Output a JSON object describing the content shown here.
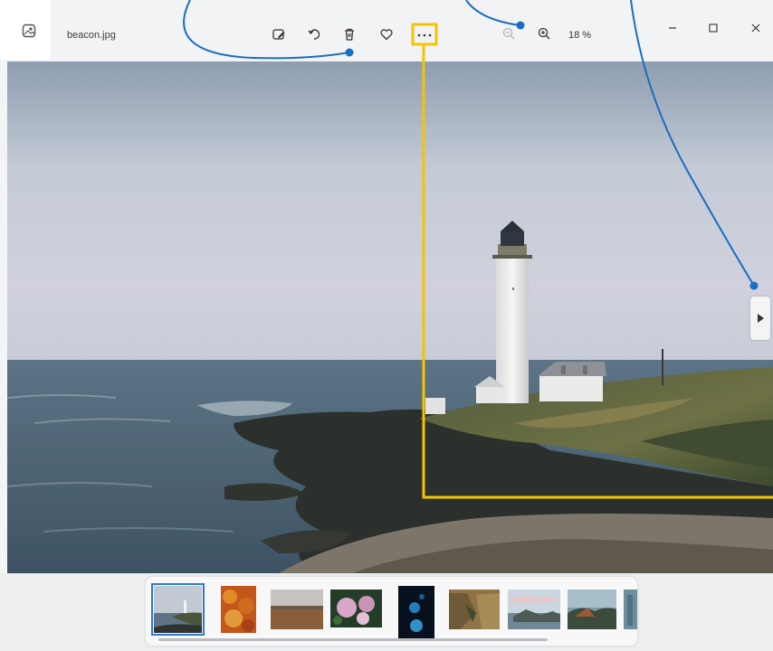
{
  "titlebar": {
    "filename": "beacon.jpg",
    "zoom_level": "18 %",
    "toolbar_icons": [
      "edit-image-icon",
      "rotate-icon",
      "delete-icon",
      "favorite-icon",
      "more-options-icon",
      "zoom-out-icon",
      "zoom-in-icon"
    ],
    "window_controls": [
      "minimize",
      "maximize",
      "close"
    ]
  },
  "photo": {
    "subject": "lighthouse-seascape",
    "sky_color": "#b9c2cf",
    "sea_color": "#4a6377"
  },
  "filmstrip": {
    "selected_index": 0,
    "thumbnails": [
      {
        "name": "thumb-beacon",
        "color": "#9fb0bd"
      },
      {
        "name": "thumb-autumn-leaves",
        "color": "#c9641e"
      },
      {
        "name": "thumb-sunset-field",
        "color": "#8a6a4c"
      },
      {
        "name": "thumb-hydrangea",
        "color": "#3d5a35"
      },
      {
        "name": "thumb-jellyfish",
        "color": "#0c1b2c"
      },
      {
        "name": "thumb-rocky-canyon",
        "color": "#8b6f45"
      },
      {
        "name": "thumb-coastal-clouds",
        "color": "#b9c7d4"
      },
      {
        "name": "thumb-coast-cliffs",
        "color": "#5f7f8f"
      },
      {
        "name": "thumb-partial-edge",
        "color": "#6f8e9c"
      }
    ]
  },
  "annotations": {
    "highlight_color": "#f5c400",
    "callout_color": "#1a6ec0"
  }
}
